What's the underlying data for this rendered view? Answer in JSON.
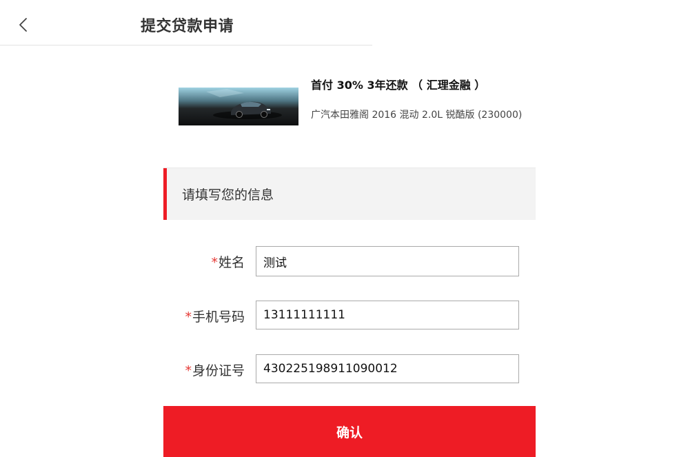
{
  "header": {
    "title": "提交贷款申请",
    "back_icon": "chevron-left-icon"
  },
  "product": {
    "plan_title": "首付 30% 3年还款 （ 汇理金融 ）",
    "car_model": "广汽本田雅阁 2016 混动 2.0L 锐酷版 (230000)"
  },
  "section": {
    "title": "请填写您的信息",
    "accent_color": "#ee1c25"
  },
  "form": {
    "required_mark": "*",
    "name_label": "姓名",
    "name_value": "测试",
    "phone_label": "手机号码",
    "phone_value": "13111111111",
    "id_label": "身份证号",
    "id_value": "430225198911090012"
  },
  "confirm": {
    "label": "确认",
    "color": "#ee1c25"
  }
}
